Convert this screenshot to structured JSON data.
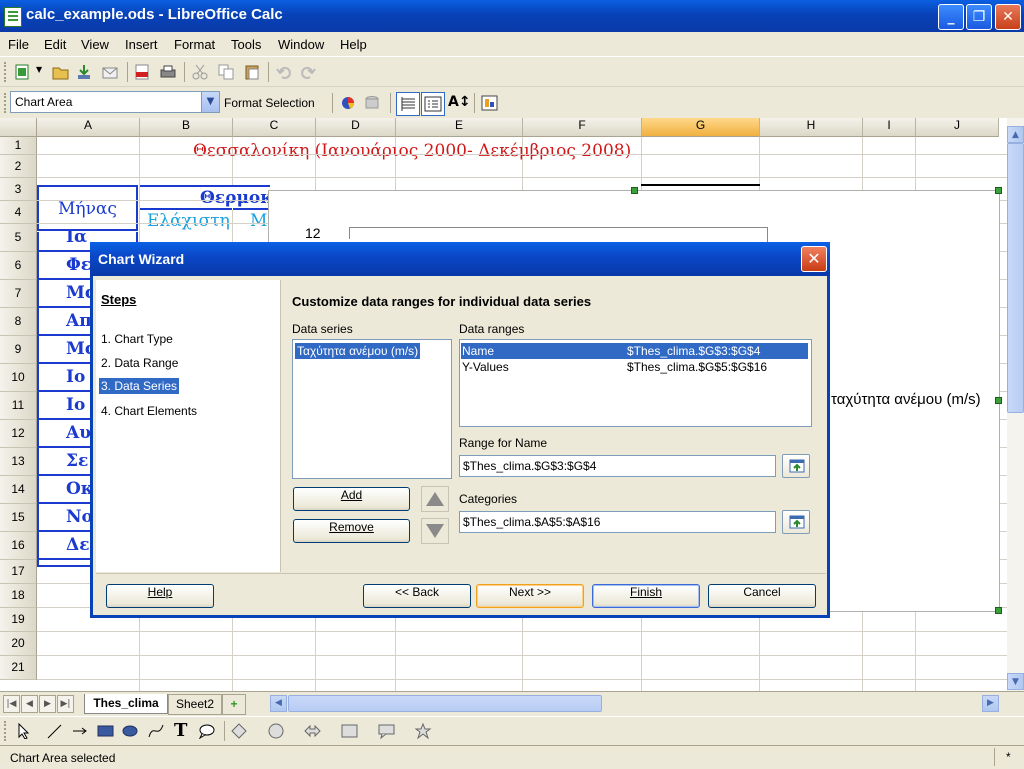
{
  "window": {
    "title": "calc_example.ods - LibreOffice Calc"
  },
  "menu": [
    "File",
    "Edit",
    "View",
    "Insert",
    "Format",
    "Tools",
    "Window",
    "Help"
  ],
  "toolbar2": {
    "chart_element": "Chart Area",
    "format_selection": "Format Selection"
  },
  "grid": {
    "columns": [
      "A",
      "B",
      "C",
      "D",
      "E",
      "F",
      "G",
      "H",
      "I",
      "J"
    ],
    "selected_column": "G",
    "rows": [
      "1",
      "2",
      "3",
      "4",
      "5",
      "6",
      "7",
      "8",
      "9",
      "10",
      "11",
      "12",
      "13",
      "14",
      "15",
      "16",
      "17",
      "18",
      "19",
      "20",
      "21"
    ],
    "title": "Θεσσαλονίκη (Ιανουάριος 2000- Δεκέμβριος 2008)",
    "a3": "Μήνας",
    "b3": "Θερμοκ",
    "b4": "Ελάχιστη",
    "c4": "Μ",
    "month_fragments": [
      "Ια",
      "Φε",
      "Μα",
      "Απ",
      "Μα",
      "Ιο",
      "Ιο",
      "Αυ",
      "Σε",
      "Οκ",
      "Νο",
      "Δε"
    ]
  },
  "chart": {
    "axis_tick": "12",
    "legend_entry": "ταχύτητα ανέμου (m/s)"
  },
  "dialog": {
    "title": "Chart Wizard",
    "steps_heading": "Steps",
    "steps": [
      "1. Chart Type",
      "2. Data Range",
      "3. Data Series",
      "4. Chart Elements"
    ],
    "active_step": 2,
    "heading": "Customize data ranges for individual data series",
    "data_series_label": "Data series",
    "data_series_items": [
      "Ταχύτητα ανέμου (m/s)"
    ],
    "data_ranges_label": "Data ranges",
    "data_ranges": [
      {
        "role": "Name",
        "range": "$Thes_clima.$G$3:$G$4"
      },
      {
        "role": "Y-Values",
        "range": "$Thes_clima.$G$5:$G$16"
      }
    ],
    "range_for_name_label": "Range for Name",
    "range_for_name_value": "$Thes_clima.$G$3:$G$4",
    "categories_label": "Categories",
    "categories_value": "$Thes_clima.$A$5:$A$16",
    "add_label": "Add",
    "remove_label": "Remove",
    "help_label": "Help",
    "back_label": "<< Back",
    "next_label": "Next >>",
    "finish_label": "Finish",
    "cancel_label": "Cancel"
  },
  "sheets": [
    "Thes_clima",
    "Sheet2"
  ],
  "active_sheet": "Thes_clima",
  "status": {
    "text": "Chart Area selected",
    "modified": "*"
  },
  "colors": {
    "title_red": "#d01818",
    "header_blue": "#1a3ad0",
    "selection": "#316ac5",
    "xp_blue": "#0a48c8"
  }
}
